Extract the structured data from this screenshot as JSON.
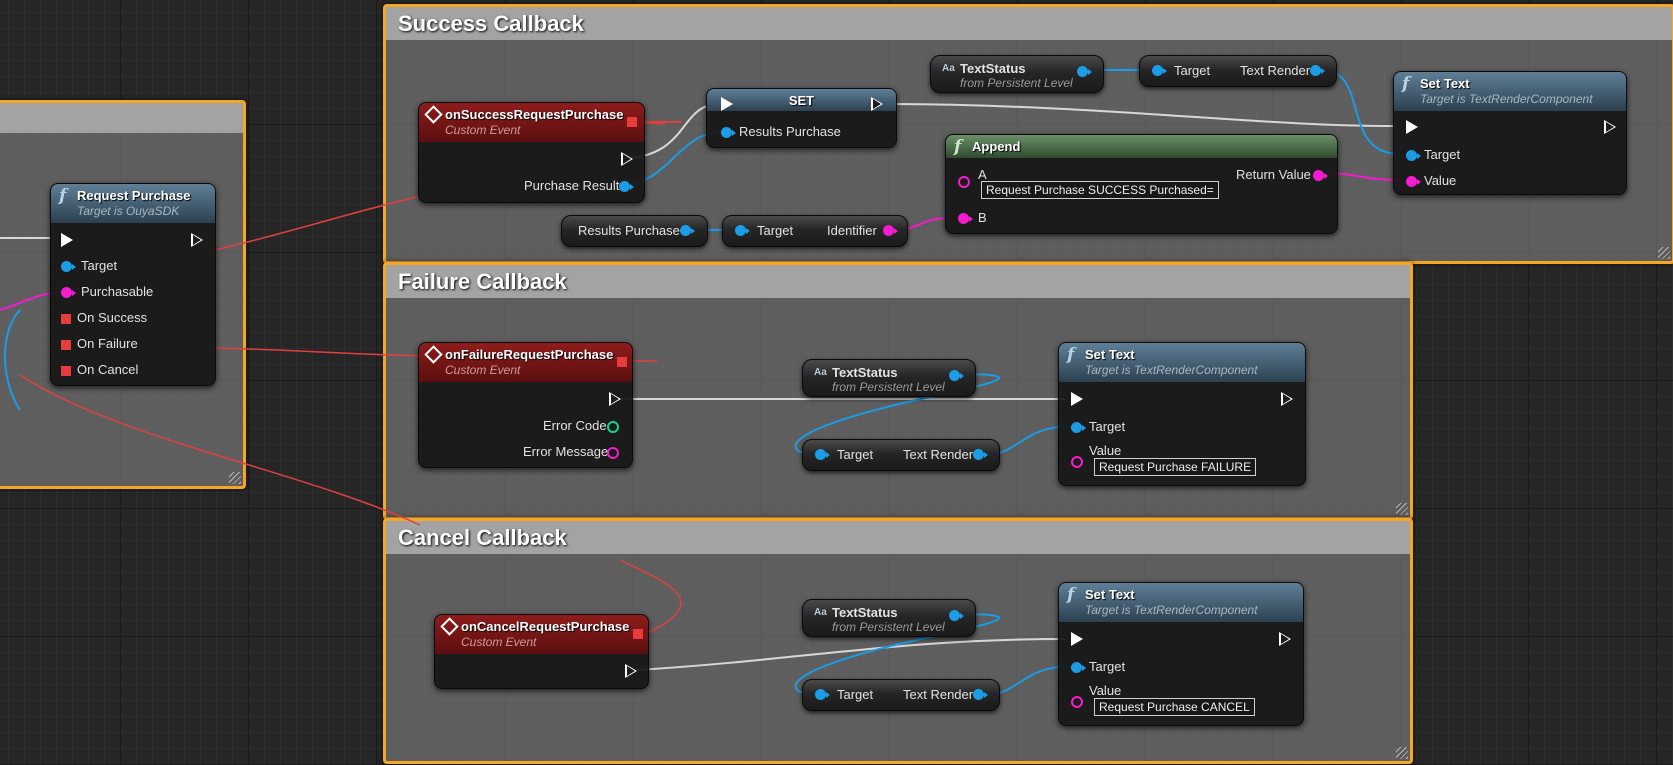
{
  "comments": {
    "success": {
      "title": "Success Callback"
    },
    "failure": {
      "title": "Failure Callback"
    },
    "cancel": {
      "title": "Cancel Callback"
    }
  },
  "request_node": {
    "title": "Request Purchase",
    "subtitle": "Target is OuyaSDK",
    "pins": {
      "target": "Target",
      "purchasable": "Purchasable",
      "on_success": "On Success",
      "on_failure": "On Failure",
      "on_cancel": "On Cancel"
    }
  },
  "success": {
    "event": {
      "title": "onSuccessRequestPurchase",
      "subtitle": "Custom Event",
      "pin": "Purchase Result"
    },
    "set": {
      "title": "SET",
      "pin": "Results Purchase"
    },
    "text_status": {
      "title": "TextStatus",
      "subtitle": "from Persistent Level"
    },
    "text_render": {
      "target": "Target",
      "output": "Text Render"
    },
    "set_text": {
      "title": "Set Text",
      "subtitle": "Target is TextRenderComponent",
      "target": "Target",
      "value": "Value"
    },
    "append": {
      "title": "Append",
      "a": "A",
      "a_value": "Request Purchase SUCCESS Purchased=",
      "b": "B",
      "return": "Return Value"
    },
    "results_var": {
      "label": "Results Purchase"
    },
    "identifier": {
      "target": "Target",
      "output": "Identifier"
    }
  },
  "failure": {
    "event": {
      "title": "onFailureRequestPurchase",
      "subtitle": "Custom Event",
      "error_code": "Error Code",
      "error_message": "Error Message"
    },
    "text_status": {
      "title": "TextStatus",
      "subtitle": "from Persistent Level"
    },
    "text_render": {
      "target": "Target",
      "output": "Text Render"
    },
    "set_text": {
      "title": "Set Text",
      "subtitle": "Target is TextRenderComponent",
      "target": "Target",
      "value": "Value",
      "value_text": "Request Purchase FAILURE"
    }
  },
  "cancel": {
    "event": {
      "title": "onCancelRequestPurchase",
      "subtitle": "Custom Event"
    },
    "text_status": {
      "title": "TextStatus",
      "subtitle": "from Persistent Level"
    },
    "text_render": {
      "target": "Target",
      "output": "Text Render"
    },
    "set_text": {
      "title": "Set Text",
      "subtitle": "Target is TextRenderComponent",
      "target": "Target",
      "value": "Value",
      "value_text": "Request Purchase CANCEL"
    }
  },
  "icons": {
    "function": "f",
    "event": "event-diamond",
    "variable": "Aa"
  },
  "colors": {
    "comment_border": "#f5a623",
    "exec_wire": "#d8d8d8",
    "object_pin": "#1b9ce6",
    "string_pin": "#f41bd0",
    "delegate_pin": "#e83b3b",
    "int_pin": "#16d28a"
  }
}
